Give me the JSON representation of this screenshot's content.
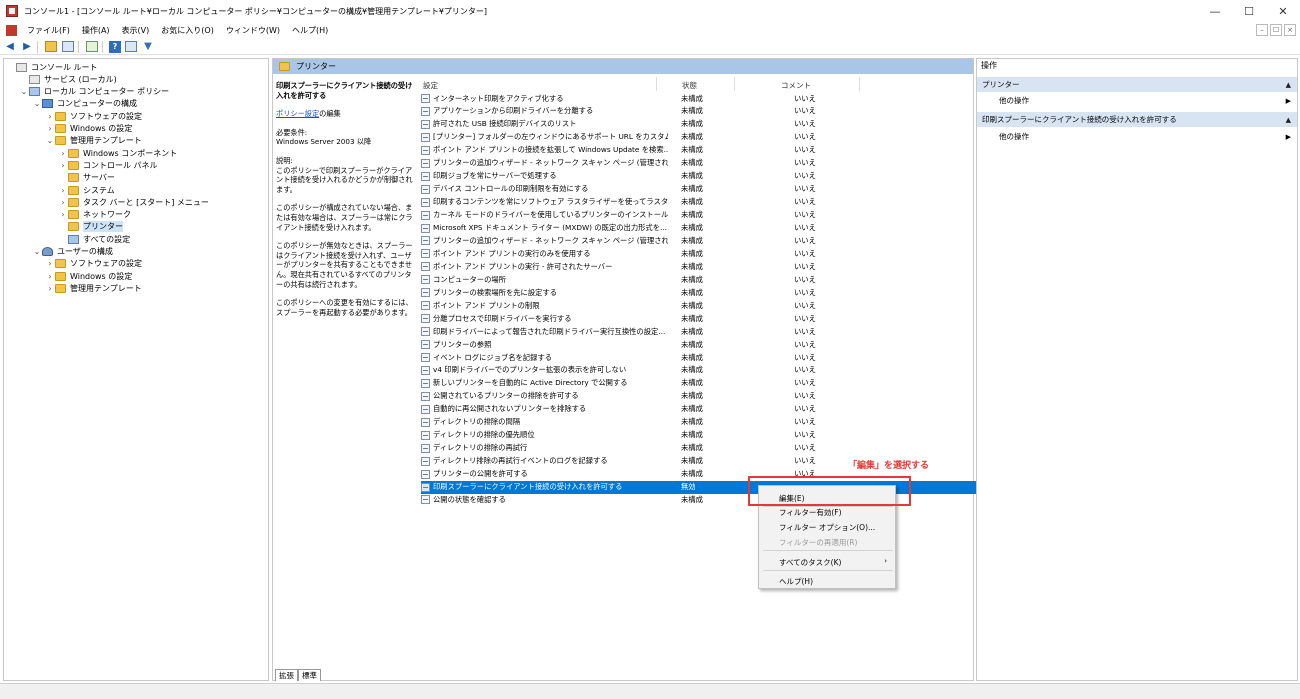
{
  "window": {
    "title": "コンソール1 - [コンソール ルート¥ローカル コンピューター ポリシー¥コンピューターの構成¥管理用テンプレート¥プリンター]",
    "controls": [
      "—",
      "☐",
      "✕"
    ],
    "inner_controls": [
      "–",
      "☐",
      "×"
    ]
  },
  "menu": [
    "ファイル(F)",
    "操作(A)",
    "表示(V)",
    "お気に入り(O)",
    "ウィンドウ(W)",
    "ヘルプ(H)"
  ],
  "tree": [
    {
      "label": "コンソール ルート",
      "level": 0,
      "exp": "",
      "icon": "root"
    },
    {
      "label": "サービス (ローカル)",
      "level": 1,
      "exp": "",
      "icon": "gear"
    },
    {
      "label": "ローカル コンピューター ポリシー",
      "level": 1,
      "exp": "⌄",
      "icon": "policy"
    },
    {
      "label": "コンピューターの構成",
      "level": 2,
      "exp": "⌄",
      "icon": "pc"
    },
    {
      "label": "ソフトウェアの設定",
      "level": 3,
      "exp": "›",
      "icon": "folder"
    },
    {
      "label": "Windows の設定",
      "level": 3,
      "exp": "›",
      "icon": "folder"
    },
    {
      "label": "管理用テンプレート",
      "level": 3,
      "exp": "⌄",
      "icon": "folder"
    },
    {
      "label": "Windows コンポーネント",
      "level": 4,
      "exp": "›",
      "icon": "folder"
    },
    {
      "label": "コントロール パネル",
      "level": 4,
      "exp": "›",
      "icon": "folder"
    },
    {
      "label": "サーバー",
      "level": 4,
      "exp": "",
      "icon": "folder"
    },
    {
      "label": "システム",
      "level": 4,
      "exp": "›",
      "icon": "folder"
    },
    {
      "label": "タスク バーと [スタート] メニュー",
      "level": 4,
      "exp": "›",
      "icon": "folder"
    },
    {
      "label": "ネットワーク",
      "level": 4,
      "exp": "›",
      "icon": "folder"
    },
    {
      "label": "プリンター",
      "level": 4,
      "exp": "",
      "icon": "folder",
      "selected": true
    },
    {
      "label": "すべての設定",
      "level": 4,
      "exp": "",
      "icon": "policy"
    },
    {
      "label": "ユーザーの構成",
      "level": 2,
      "exp": "⌄",
      "icon": "users"
    },
    {
      "label": "ソフトウェアの設定",
      "level": 3,
      "exp": "›",
      "icon": "folder"
    },
    {
      "label": "Windows の設定",
      "level": 3,
      "exp": "›",
      "icon": "folder"
    },
    {
      "label": "管理用テンプレート",
      "level": 3,
      "exp": "›",
      "icon": "folder"
    }
  ],
  "middle": {
    "header": "プリンター",
    "description": {
      "title": "印刷スプーラーにクライアント接続の受け入れを許可する",
      "link": "ポリシー設定",
      "link_suffix": "の編集",
      "req_label": "必要条件:",
      "req_value": "Windows Server 2003 以降",
      "desc_label": "説明:",
      "p1": "このポリシーで印刷スプーラーがクライアント接続を受け入れるかどうかが制御されます。",
      "p2": "このポリシーが構成されていない場合、または有効な場合は、スプーラーは常にクライアント接続を受け入れます。",
      "p3": "このポリシーが無効なときは、スプーラーはクライアント接続を受け入れず、ユーザーがプリンターを共有することもできません。現在共有されているすべてのプリンターの共有は続行されます。",
      "p4": "このポリシーへの変更を有効にするには、スプーラーを再起動する必要があります。"
    },
    "columns": {
      "setting": "設定",
      "state": "状態",
      "comment": "コメント"
    },
    "settings": [
      {
        "name": "インターネット印刷をアクティブ化する",
        "state": "未構成",
        "comment": "いいえ"
      },
      {
        "name": "アプリケーションから印刷ドライバーを分離する",
        "state": "未構成",
        "comment": "いいえ"
      },
      {
        "name": "許可された USB 接続印刷デバイスのリスト",
        "state": "未構成",
        "comment": "いいえ"
      },
      {
        "name": "[プリンター] フォルダーの左ウィンドウにあるサポート URL をカスタム設...",
        "state": "未構成",
        "comment": "いいえ"
      },
      {
        "name": "ポイント アンド プリントの接続を拡張して Windows Update を検索...",
        "state": "未構成",
        "comment": "いいえ"
      },
      {
        "name": "プリンターの追加ウィザード - ネットワーク スキャン ページ (管理された...",
        "state": "未構成",
        "comment": "いいえ"
      },
      {
        "name": "印刷ジョブを常にサーバーで処理する",
        "state": "未構成",
        "comment": "いいえ"
      },
      {
        "name": "デバイス コントロールの印刷制限を有効にする",
        "state": "未構成",
        "comment": "いいえ"
      },
      {
        "name": "印刷するコンテンツを常にソフトウェア ラスタライザーを使ってラスタライ...",
        "state": "未構成",
        "comment": "いいえ"
      },
      {
        "name": "カーネル モードのドライバーを使用しているプリンターのインストールを禁...",
        "state": "未構成",
        "comment": "いいえ"
      },
      {
        "name": "Microsoft XPS ドキュメント ライター (MXDW) の既定の出力形式を...",
        "state": "未構成",
        "comment": "いいえ"
      },
      {
        "name": "プリンターの追加ウィザード - ネットワーク スキャン ページ (管理されて...",
        "state": "未構成",
        "comment": "いいえ"
      },
      {
        "name": "ポイント アンド プリントの実行のみを使用する",
        "state": "未構成",
        "comment": "いいえ"
      },
      {
        "name": "ポイント アンド プリントの実行 - 許可されたサーバー",
        "state": "未構成",
        "comment": "いいえ"
      },
      {
        "name": "コンピューターの場所",
        "state": "未構成",
        "comment": "いいえ"
      },
      {
        "name": "プリンターの検索場所を先に設定する",
        "state": "未構成",
        "comment": "いいえ"
      },
      {
        "name": "ポイント アンド プリントの制限",
        "state": "未構成",
        "comment": "いいえ"
      },
      {
        "name": "分離プロセスで印刷ドライバーを実行する",
        "state": "未構成",
        "comment": "いいえ"
      },
      {
        "name": "印刷ドライバーによって報告された印刷ドライバー実行互換性の設定...",
        "state": "未構成",
        "comment": "いいえ"
      },
      {
        "name": "プリンターの参照",
        "state": "未構成",
        "comment": "いいえ"
      },
      {
        "name": "イベント ログにジョブ名を記録する",
        "state": "未構成",
        "comment": "いいえ"
      },
      {
        "name": "v4 印刷ドライバーでのプリンター拡張の表示を許可しない",
        "state": "未構成",
        "comment": "いいえ"
      },
      {
        "name": "新しいプリンターを自動的に Active Directory で公開する",
        "state": "未構成",
        "comment": "いいえ"
      },
      {
        "name": "公開されているプリンターの排除を許可する",
        "state": "未構成",
        "comment": "いいえ"
      },
      {
        "name": "自動的に再公開されないプリンターを排除する",
        "state": "未構成",
        "comment": "いいえ"
      },
      {
        "name": "ディレクトリの排除の間隔",
        "state": "未構成",
        "comment": "いいえ"
      },
      {
        "name": "ディレクトリの排除の優先順位",
        "state": "未構成",
        "comment": "いいえ"
      },
      {
        "name": "ディレクトリの排除の再試行",
        "state": "未構成",
        "comment": "いいえ"
      },
      {
        "name": "ディレクトリ排除の再試行イベントのログを記録する",
        "state": "未構成",
        "comment": "いいえ"
      },
      {
        "name": "プリンターの公開を許可する",
        "state": "未構成",
        "comment": "いいえ"
      },
      {
        "name": "印刷スプーラーにクライアント接続の受け入れを許可する",
        "state": "無効",
        "comment": "",
        "selected": true
      },
      {
        "name": "公開の状態を確認する",
        "state": "未構成",
        "comment": ""
      }
    ],
    "tabs": [
      "拡張",
      "標準"
    ]
  },
  "actions": {
    "header": "操作",
    "section1": "プリンター",
    "section1_item": "他の操作",
    "section2": "印刷スプーラーにクライアント接続の受け入れを許可する",
    "section2_item": "他の操作"
  },
  "context_menu": {
    "edit": "編集(E)",
    "filter_on": "フィルター有効(F)",
    "filter_options": "フィルター オプション(O)...",
    "reapply_filter": "フィルターの再適用(R)",
    "all_tasks": "すべてのタスク(K)",
    "help": "ヘルプ(H)"
  },
  "annotation": "「編集」を選択する",
  "colors": {
    "selection": "#0078d7",
    "annotation": "#e53935",
    "pane_header": "#a9c6e8"
  }
}
